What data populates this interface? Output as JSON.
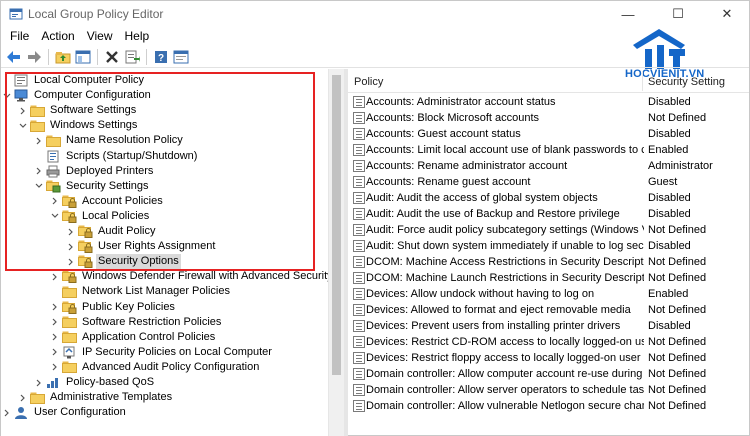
{
  "window": {
    "title": "Local Group Policy Editor",
    "minimize_glyph": "—",
    "maximize_glyph": "☐",
    "close_glyph": "✕"
  },
  "menu": [
    "File",
    "Action",
    "View",
    "Help"
  ],
  "toolbar": {
    "icons": [
      "back-icon",
      "forward-icon",
      "up-folder-icon",
      "show-hide-tree-icon",
      "delete-icon",
      "export-list-icon",
      "help-icon",
      "properties-icon"
    ]
  },
  "logo": {
    "name": "hocvienit-logo",
    "text": "HOCVIENIT.VN",
    "brand_color": "#1466c8"
  },
  "tree": [
    {
      "label": "Local Computer Policy",
      "level": 0,
      "chevron": "",
      "icon": "computer-policy-icon"
    },
    {
      "label": "Computer Configuration",
      "level": 0,
      "chevron": "down",
      "icon": "computer-icon"
    },
    {
      "label": "Software Settings",
      "level": 1,
      "chevron": "right",
      "icon": "folder-icon"
    },
    {
      "label": "Windows Settings",
      "level": 1,
      "chevron": "down",
      "icon": "folder-icon"
    },
    {
      "label": "Name Resolution Policy",
      "level": 2,
      "chevron": "right",
      "icon": "folder-icon"
    },
    {
      "label": "Scripts (Startup/Shutdown)",
      "level": 2,
      "chevron": "",
      "icon": "script-icon"
    },
    {
      "label": "Deployed Printers",
      "level": 2,
      "chevron": "right",
      "icon": "printer-icon"
    },
    {
      "label": "Security Settings",
      "level": 2,
      "chevron": "down",
      "icon": "security-settings-icon"
    },
    {
      "label": "Account Policies",
      "level": 3,
      "chevron": "right",
      "icon": "lock-folder-icon"
    },
    {
      "label": "Local Policies",
      "level": 3,
      "chevron": "down",
      "icon": "lock-folder-icon"
    },
    {
      "label": "Audit Policy",
      "level": 4,
      "chevron": "right",
      "icon": "lock-folder-icon"
    },
    {
      "label": "User Rights Assignment",
      "level": 4,
      "chevron": "right",
      "icon": "lock-folder-icon"
    },
    {
      "label": "Security Options",
      "level": 4,
      "chevron": "right",
      "icon": "lock-folder-icon",
      "selected": true
    },
    {
      "label": "Windows Defender Firewall with Advanced Security",
      "level": 3,
      "chevron": "right",
      "icon": "lock-folder-icon"
    },
    {
      "label": "Network List Manager Policies",
      "level": 3,
      "chevron": "",
      "icon": "folder-icon"
    },
    {
      "label": "Public Key Policies",
      "level": 3,
      "chevron": "right",
      "icon": "lock-folder-icon"
    },
    {
      "label": "Software Restriction Policies",
      "level": 3,
      "chevron": "right",
      "icon": "folder-icon"
    },
    {
      "label": "Application Control Policies",
      "level": 3,
      "chevron": "right",
      "icon": "folder-icon"
    },
    {
      "label": "IP Security Policies on Local Computer",
      "level": 3,
      "chevron": "right",
      "icon": "ipsec-icon"
    },
    {
      "label": "Advanced Audit Policy Configuration",
      "level": 3,
      "chevron": "right",
      "icon": "folder-icon"
    },
    {
      "label": "Policy-based QoS",
      "level": 2,
      "chevron": "right",
      "icon": "qos-icon"
    },
    {
      "label": "Administrative Templates",
      "level": 1,
      "chevron": "right",
      "icon": "folder-icon"
    },
    {
      "label": "User Configuration",
      "level": 0,
      "chevron": "right",
      "icon": "user-icon"
    }
  ],
  "list": {
    "columns": {
      "policy": "Policy",
      "setting": "Security Setting"
    },
    "rows": [
      {
        "policy": "Accounts: Administrator account status",
        "setting": "Disabled"
      },
      {
        "policy": "Accounts: Block Microsoft accounts",
        "setting": "Not Defined"
      },
      {
        "policy": "Accounts: Guest account status",
        "setting": "Disabled"
      },
      {
        "policy": "Accounts: Limit local account use of blank passwords to co...",
        "setting": "Enabled"
      },
      {
        "policy": "Accounts: Rename administrator account",
        "setting": "Administrator"
      },
      {
        "policy": "Accounts: Rename guest account",
        "setting": "Guest"
      },
      {
        "policy": "Audit: Audit the access of global system objects",
        "setting": "Disabled"
      },
      {
        "policy": "Audit: Audit the use of Backup and Restore privilege",
        "setting": "Disabled"
      },
      {
        "policy": "Audit: Force audit policy subcategory settings (Windows Vis...",
        "setting": "Not Defined"
      },
      {
        "policy": "Audit: Shut down system immediately if unable to log secur...",
        "setting": "Disabled"
      },
      {
        "policy": "DCOM: Machine Access Restrictions in Security Descriptor D...",
        "setting": "Not Defined"
      },
      {
        "policy": "DCOM: Machine Launch Restrictions in Security Descriptor ...",
        "setting": "Not Defined"
      },
      {
        "policy": "Devices: Allow undock without having to log on",
        "setting": "Enabled"
      },
      {
        "policy": "Devices: Allowed to format and eject removable media",
        "setting": "Not Defined"
      },
      {
        "policy": "Devices: Prevent users from installing printer drivers",
        "setting": "Disabled"
      },
      {
        "policy": "Devices: Restrict CD-ROM access to locally logged-on user ...",
        "setting": "Not Defined"
      },
      {
        "policy": "Devices: Restrict floppy access to locally logged-on user only",
        "setting": "Not Defined"
      },
      {
        "policy": "Domain controller: Allow computer account re-use during d...",
        "setting": "Not Defined"
      },
      {
        "policy": "Domain controller: Allow server operators to schedule tasks",
        "setting": "Not Defined"
      },
      {
        "policy": "Domain controller: Allow vulnerable Netlogon secure chann...",
        "setting": "Not Defined"
      }
    ]
  }
}
